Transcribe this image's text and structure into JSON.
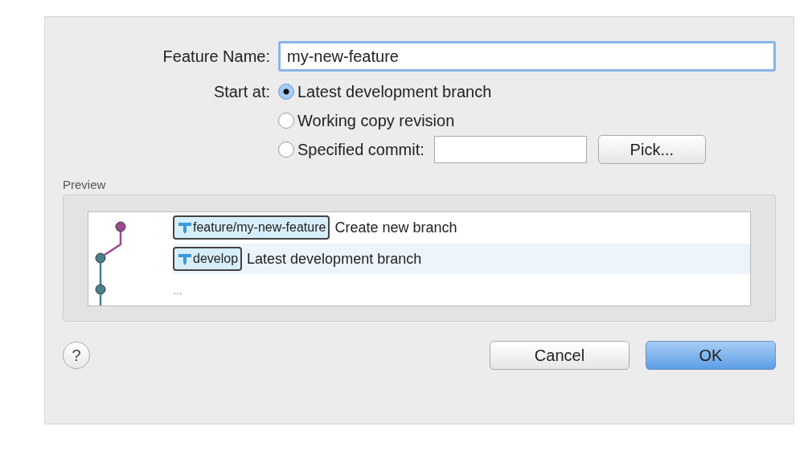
{
  "feature_name": {
    "label": "Feature Name:",
    "value": "my-new-feature"
  },
  "start_at": {
    "label": "Start at:",
    "options": [
      {
        "label": "Latest development branch",
        "selected": true,
        "kind": "plain"
      },
      {
        "label": "Working copy revision",
        "selected": false,
        "kind": "plain"
      },
      {
        "label": "Specified commit:",
        "selected": false,
        "kind": "commit"
      }
    ],
    "pick_button": "Pick..."
  },
  "preview": {
    "label": "Preview",
    "rows": [
      {
        "kind": "branch",
        "branch": "feature/my-new-feature",
        "message": "Create new branch",
        "color": "#9b4a8e"
      },
      {
        "kind": "branch",
        "branch": "develop",
        "message": "Latest development branch",
        "color": "#4a7f8c"
      },
      {
        "kind": "more",
        "message": "...",
        "color": "#4a7f8c"
      }
    ]
  },
  "buttons": {
    "help": "?",
    "cancel": "Cancel",
    "ok": "OK"
  }
}
